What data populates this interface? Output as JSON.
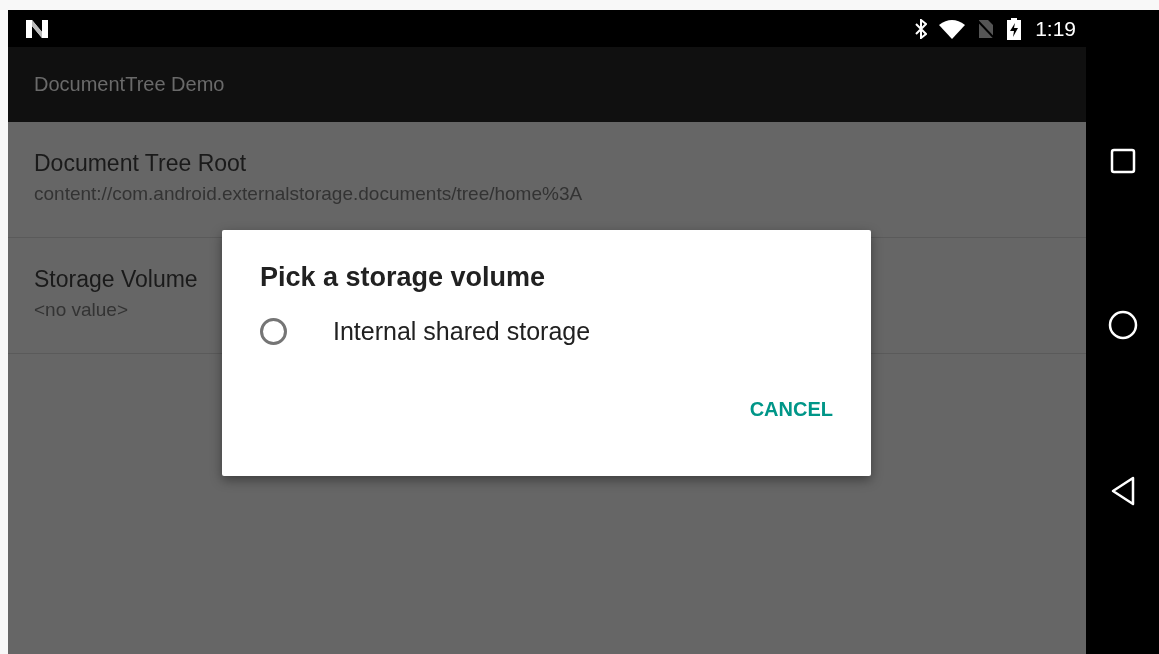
{
  "status_bar": {
    "time": "1:19"
  },
  "app_bar": {
    "title": "DocumentTree Demo"
  },
  "preferences": [
    {
      "title": "Document Tree Root",
      "summary": "content://com.android.externalstorage.documents/tree/home%3A"
    },
    {
      "title": "Storage Volume",
      "summary": "<no value>"
    }
  ],
  "dialog": {
    "title": "Pick a storage volume",
    "options": [
      {
        "label": "Internal shared storage",
        "selected": false
      }
    ],
    "buttons": [
      "CANCEL"
    ]
  }
}
